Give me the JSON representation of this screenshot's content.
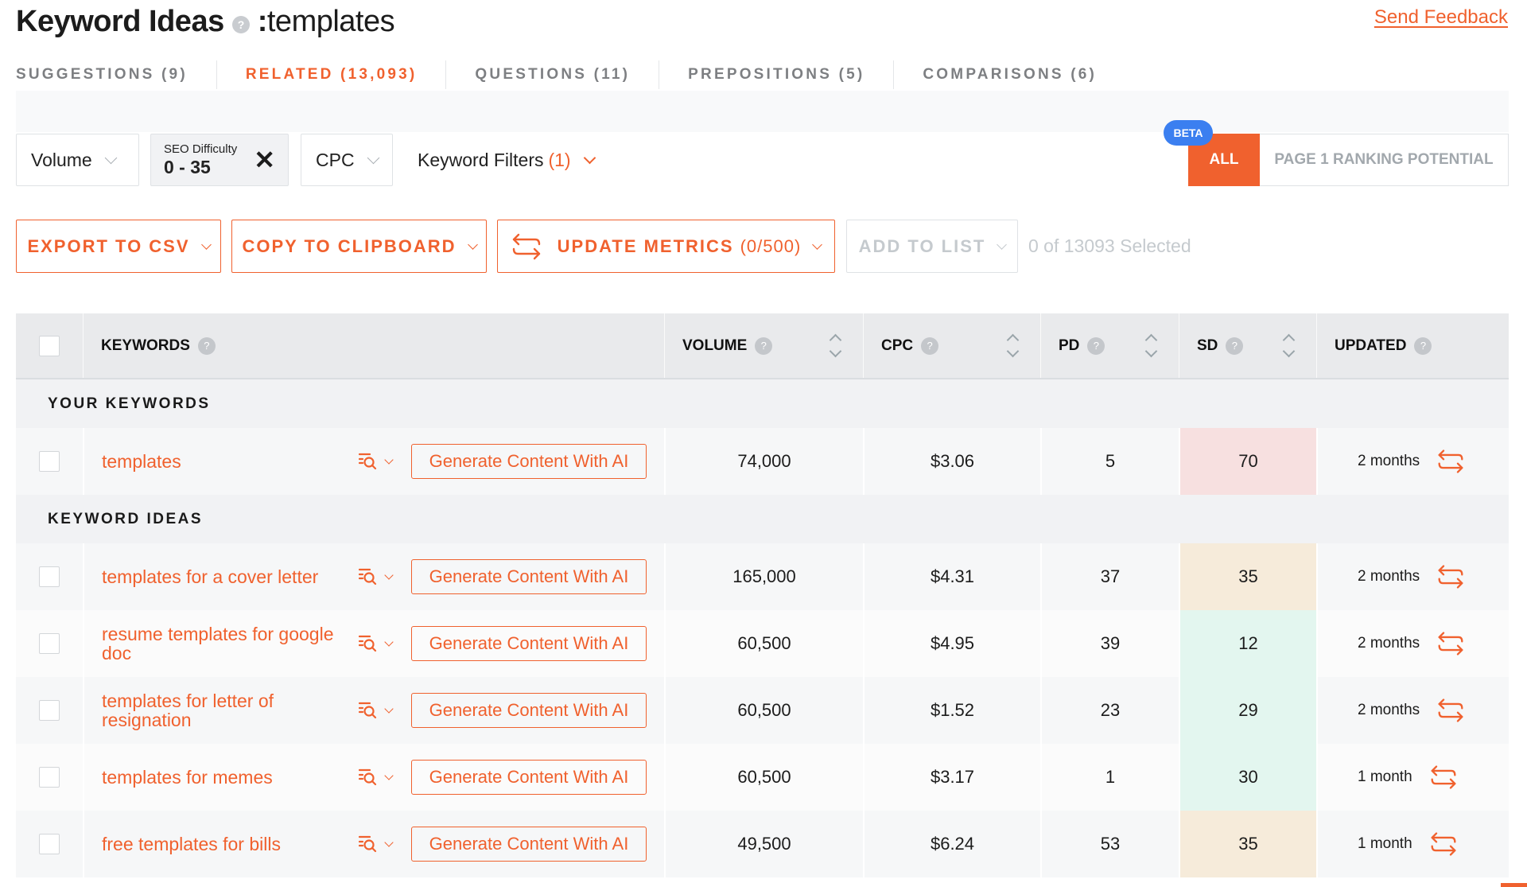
{
  "header": {
    "title": "Keyword Ideas",
    "help_glyph": "?",
    "separator": ":",
    "keyword": "templates",
    "feedback_link": "Send Feedback"
  },
  "tabs": [
    {
      "label": "SUGGESTIONS (9)",
      "active": false
    },
    {
      "label": "RELATED (13,093)",
      "active": true
    },
    {
      "label": "QUESTIONS (11)",
      "active": false
    },
    {
      "label": "PREPOSITIONS (5)",
      "active": false
    },
    {
      "label": "COMPARISONS (6)",
      "active": false
    }
  ],
  "filters": {
    "volume": "Volume",
    "seo_difficulty_label": "SEO Difficulty",
    "seo_difficulty_value": "0 - 35",
    "clear_glyph": "✕",
    "cpc": "CPC",
    "keyword_filters": "Keyword Filters",
    "keyword_filters_count": "(1)"
  },
  "segment": {
    "beta_badge": "BETA",
    "all": "ALL",
    "page1": "PAGE 1 RANKING POTENTIAL",
    "selected": "all"
  },
  "actions": {
    "export_csv": "EXPORT TO CSV",
    "copy_clipboard": "COPY TO CLIPBOARD",
    "update_metrics": "UPDATE METRICS",
    "update_metrics_count": "(0/500)",
    "add_to_list": "ADD TO LIST",
    "selection_status": "0 of 13093 Selected"
  },
  "table": {
    "columns": [
      "KEYWORDS",
      "VOLUME",
      "CPC",
      "PD",
      "SD",
      "UPDATED"
    ],
    "your_keywords_label": "YOUR KEYWORDS",
    "keyword_ideas_label": "KEYWORD IDEAS",
    "generate_button": "Generate Content With AI",
    "your_keywords": [
      {
        "keyword": "templates",
        "volume": "74,000",
        "cpc": "$3.06",
        "pd": "5",
        "sd": "70",
        "sd_color": "#f7e0e0",
        "updated": "2 months"
      }
    ],
    "keyword_ideas": [
      {
        "keyword": "templates for a cover letter",
        "volume": "165,000",
        "cpc": "$4.31",
        "pd": "37",
        "sd": "35",
        "sd_color": "#f6ebda",
        "updated": "2 months"
      },
      {
        "keyword": "resume templates for google doc",
        "volume": "60,500",
        "cpc": "$4.95",
        "pd": "39",
        "sd": "12",
        "sd_color": "#e3f6ef",
        "updated": "2 months"
      },
      {
        "keyword": "templates for letter of resignation",
        "volume": "60,500",
        "cpc": "$1.52",
        "pd": "23",
        "sd": "29",
        "sd_color": "#e3f6ef",
        "updated": "2 months"
      },
      {
        "keyword": "templates for memes",
        "volume": "60,500",
        "cpc": "$3.17",
        "pd": "1",
        "sd": "30",
        "sd_color": "#e3f6ef",
        "updated": "1 month"
      },
      {
        "keyword": "free templates for bills",
        "volume": "49,500",
        "cpc": "$6.24",
        "pd": "53",
        "sd": "35",
        "sd_color": "#f6ebda",
        "updated": "1 month"
      }
    ]
  },
  "colors": {
    "accent": "#f0612e",
    "beta": "#3b7ff0",
    "sd_high": "#f7e0e0",
    "sd_medium": "#f6ebda",
    "sd_low": "#e3f6ef"
  },
  "icons": {
    "help": "question-circle-icon",
    "chevron": "chevron-down-icon",
    "clear": "close-icon",
    "refresh": "refresh-arrows-icon",
    "serp": "serp-search-icon",
    "sort": "sort-arrows-icon"
  }
}
